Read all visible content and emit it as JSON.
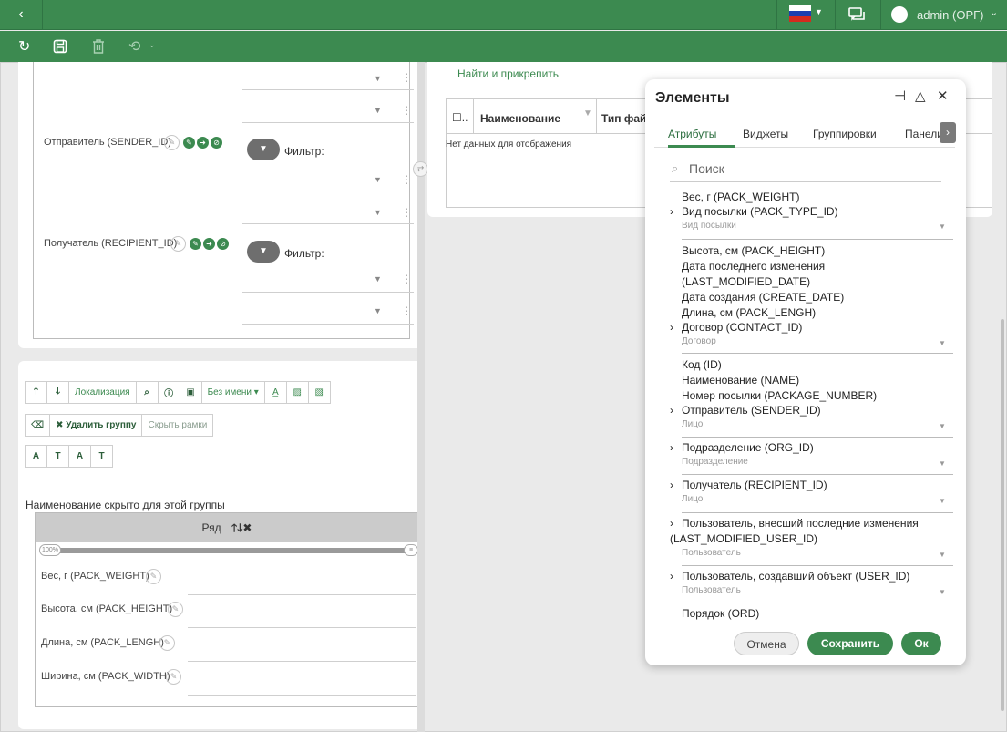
{
  "header": {
    "back_icon": "chevron-left-icon",
    "username": "admin (ОРГ)",
    "colors": {
      "primary": "#3c8a50",
      "primary_dark": "#2f7443"
    }
  },
  "toolbar": {
    "icons": [
      "refresh-icon",
      "save-icon",
      "trash-icon",
      "history-icon",
      "chevron-down-icon"
    ]
  },
  "left": {
    "fields": [
      {
        "label": "Отправитель (SENDER_ID)",
        "filter_label": "Фильтр:"
      },
      {
        "label": "Получатель (RECIPIENT_ID)",
        "filter_label": "Фильтр:"
      }
    ],
    "toolbar_buttons": [
      "Локализация",
      "Без имени ▾"
    ],
    "delete_group": "✖ Удалить группу",
    "hide_frames": "Скрыть рамки",
    "group_note": "Наименование скрыто для этой группы",
    "row_title": "Ряд",
    "slider_left": "100%",
    "group_fields": [
      "Вес, г (PACK_WEIGHT)",
      "Высота, см (PACK_HEIGHT)",
      "Длина, см (PACK_LENGH)",
      "Ширина, см (PACK_WIDTH)"
    ]
  },
  "right": {
    "find_attach": "Найти и прикрепить",
    "columns": [
      "Наименование",
      "Тип фай"
    ],
    "no_data": "Нет данных для отображения"
  },
  "dialog": {
    "title": "Элементы",
    "tabs": [
      "Атрибуты",
      "Виджеты",
      "Группировки",
      "Панели"
    ],
    "search_placeholder": "Поиск",
    "attributes": [
      {
        "label": "Вес, г (PACK_WEIGHT)"
      },
      {
        "label": "Вид посылки (PACK_TYPE_ID)",
        "expand": true,
        "sub": "Вид посылки"
      },
      {
        "label": "Высота, см (PACK_HEIGHT)"
      },
      {
        "label": "Дата последнего изменения"
      },
      {
        "label": "(LAST_MODIFIED_DATE)"
      },
      {
        "label": "Дата создания (CREATE_DATE)"
      },
      {
        "label": "Длина, см (PACK_LENGH)"
      },
      {
        "label": "Договор (CONTACT_ID)",
        "expand": true,
        "sub": "Договор"
      },
      {
        "label": "Код (ID)"
      },
      {
        "label": "Наименование (NAME)"
      },
      {
        "label": "Номер посылки (PACKAGE_NUMBER)"
      },
      {
        "label": "Отправитель (SENDER_ID)",
        "expand": true,
        "sub": "Лицо"
      },
      {
        "label": "Подразделение (ORG_ID)",
        "expand": true,
        "sub": "Подразделение"
      },
      {
        "label": "Получатель (RECIPIENT_ID)",
        "expand": true,
        "sub": "Лицо"
      },
      {
        "label": "Пользователь, внесший последние изменения",
        "expand": true
      },
      {
        "label": "(LAST_MODIFIED_USER_ID)",
        "sub": "Пользователь"
      },
      {
        "label": "Пользователь, создавший объект (USER_ID)",
        "expand": true,
        "sub": "Пользователь"
      },
      {
        "label": "Порядок (ORD)"
      }
    ],
    "cancel": "Отмена",
    "save": "Сохранить",
    "ok": "Ок"
  }
}
